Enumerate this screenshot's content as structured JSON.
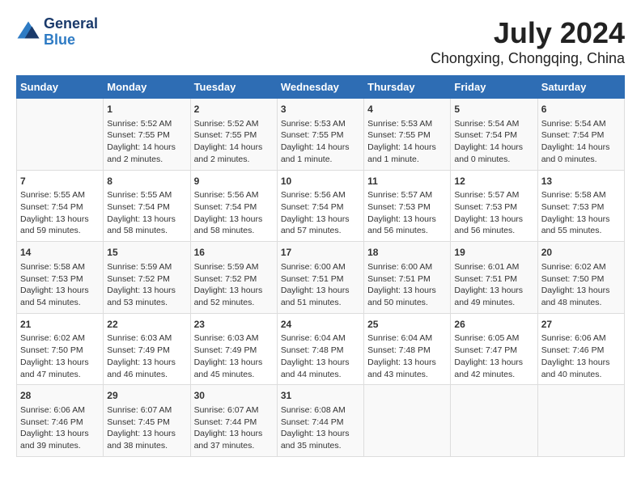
{
  "header": {
    "logo_line1": "General",
    "logo_line2": "Blue",
    "title": "July 2024",
    "subtitle": "Chongxing, Chongqing, China"
  },
  "calendar": {
    "days_of_week": [
      "Sunday",
      "Monday",
      "Tuesday",
      "Wednesday",
      "Thursday",
      "Friday",
      "Saturday"
    ],
    "weeks": [
      [
        {
          "day": "",
          "info": ""
        },
        {
          "day": "1",
          "info": "Sunrise: 5:52 AM\nSunset: 7:55 PM\nDaylight: 14 hours\nand 2 minutes."
        },
        {
          "day": "2",
          "info": "Sunrise: 5:52 AM\nSunset: 7:55 PM\nDaylight: 14 hours\nand 2 minutes."
        },
        {
          "day": "3",
          "info": "Sunrise: 5:53 AM\nSunset: 7:55 PM\nDaylight: 14 hours\nand 1 minute."
        },
        {
          "day": "4",
          "info": "Sunrise: 5:53 AM\nSunset: 7:55 PM\nDaylight: 14 hours\nand 1 minute."
        },
        {
          "day": "5",
          "info": "Sunrise: 5:54 AM\nSunset: 7:54 PM\nDaylight: 14 hours\nand 0 minutes."
        },
        {
          "day": "6",
          "info": "Sunrise: 5:54 AM\nSunset: 7:54 PM\nDaylight: 14 hours\nand 0 minutes."
        }
      ],
      [
        {
          "day": "7",
          "info": "Sunrise: 5:55 AM\nSunset: 7:54 PM\nDaylight: 13 hours\nand 59 minutes."
        },
        {
          "day": "8",
          "info": "Sunrise: 5:55 AM\nSunset: 7:54 PM\nDaylight: 13 hours\nand 58 minutes."
        },
        {
          "day": "9",
          "info": "Sunrise: 5:56 AM\nSunset: 7:54 PM\nDaylight: 13 hours\nand 58 minutes."
        },
        {
          "day": "10",
          "info": "Sunrise: 5:56 AM\nSunset: 7:54 PM\nDaylight: 13 hours\nand 57 minutes."
        },
        {
          "day": "11",
          "info": "Sunrise: 5:57 AM\nSunset: 7:53 PM\nDaylight: 13 hours\nand 56 minutes."
        },
        {
          "day": "12",
          "info": "Sunrise: 5:57 AM\nSunset: 7:53 PM\nDaylight: 13 hours\nand 56 minutes."
        },
        {
          "day": "13",
          "info": "Sunrise: 5:58 AM\nSunset: 7:53 PM\nDaylight: 13 hours\nand 55 minutes."
        }
      ],
      [
        {
          "day": "14",
          "info": "Sunrise: 5:58 AM\nSunset: 7:53 PM\nDaylight: 13 hours\nand 54 minutes."
        },
        {
          "day": "15",
          "info": "Sunrise: 5:59 AM\nSunset: 7:52 PM\nDaylight: 13 hours\nand 53 minutes."
        },
        {
          "day": "16",
          "info": "Sunrise: 5:59 AM\nSunset: 7:52 PM\nDaylight: 13 hours\nand 52 minutes."
        },
        {
          "day": "17",
          "info": "Sunrise: 6:00 AM\nSunset: 7:51 PM\nDaylight: 13 hours\nand 51 minutes."
        },
        {
          "day": "18",
          "info": "Sunrise: 6:00 AM\nSunset: 7:51 PM\nDaylight: 13 hours\nand 50 minutes."
        },
        {
          "day": "19",
          "info": "Sunrise: 6:01 AM\nSunset: 7:51 PM\nDaylight: 13 hours\nand 49 minutes."
        },
        {
          "day": "20",
          "info": "Sunrise: 6:02 AM\nSunset: 7:50 PM\nDaylight: 13 hours\nand 48 minutes."
        }
      ],
      [
        {
          "day": "21",
          "info": "Sunrise: 6:02 AM\nSunset: 7:50 PM\nDaylight: 13 hours\nand 47 minutes."
        },
        {
          "day": "22",
          "info": "Sunrise: 6:03 AM\nSunset: 7:49 PM\nDaylight: 13 hours\nand 46 minutes."
        },
        {
          "day": "23",
          "info": "Sunrise: 6:03 AM\nSunset: 7:49 PM\nDaylight: 13 hours\nand 45 minutes."
        },
        {
          "day": "24",
          "info": "Sunrise: 6:04 AM\nSunset: 7:48 PM\nDaylight: 13 hours\nand 44 minutes."
        },
        {
          "day": "25",
          "info": "Sunrise: 6:04 AM\nSunset: 7:48 PM\nDaylight: 13 hours\nand 43 minutes."
        },
        {
          "day": "26",
          "info": "Sunrise: 6:05 AM\nSunset: 7:47 PM\nDaylight: 13 hours\nand 42 minutes."
        },
        {
          "day": "27",
          "info": "Sunrise: 6:06 AM\nSunset: 7:46 PM\nDaylight: 13 hours\nand 40 minutes."
        }
      ],
      [
        {
          "day": "28",
          "info": "Sunrise: 6:06 AM\nSunset: 7:46 PM\nDaylight: 13 hours\nand 39 minutes."
        },
        {
          "day": "29",
          "info": "Sunrise: 6:07 AM\nSunset: 7:45 PM\nDaylight: 13 hours\nand 38 minutes."
        },
        {
          "day": "30",
          "info": "Sunrise: 6:07 AM\nSunset: 7:44 PM\nDaylight: 13 hours\nand 37 minutes."
        },
        {
          "day": "31",
          "info": "Sunrise: 6:08 AM\nSunset: 7:44 PM\nDaylight: 13 hours\nand 35 minutes."
        },
        {
          "day": "",
          "info": ""
        },
        {
          "day": "",
          "info": ""
        },
        {
          "day": "",
          "info": ""
        }
      ]
    ]
  }
}
